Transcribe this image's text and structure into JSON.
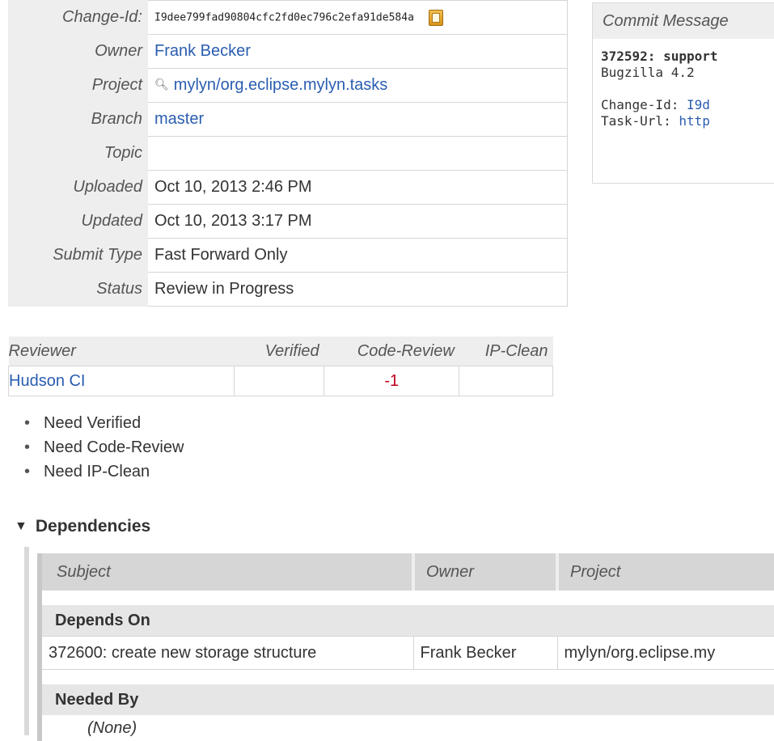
{
  "info": {
    "rows": [
      {
        "label": "Change-Id:",
        "value": "I9dee799fad90804cfc2fd0ec796c2efa91de584a"
      },
      {
        "label": "Owner",
        "value": "Frank Becker"
      },
      {
        "label": "Project",
        "value": "mylyn/org.eclipse.mylyn.tasks"
      },
      {
        "label": "Branch",
        "value": "master"
      },
      {
        "label": "Topic",
        "value": ""
      },
      {
        "label": "Uploaded",
        "value": "Oct 10, 2013 2:46 PM"
      },
      {
        "label": "Updated",
        "value": "Oct 10, 2013 3:17 PM"
      },
      {
        "label": "Submit Type",
        "value": "Fast Forward Only"
      },
      {
        "label": "Status",
        "value": "Review in Progress"
      }
    ]
  },
  "commit": {
    "header": "Commit Message",
    "subject": "372592: support",
    "line2": "Bugzilla 4.2",
    "change_id_key": "Change-Id: ",
    "change_id_val": "I9d",
    "task_url_key": "Task-Url: ",
    "task_url_val": "http"
  },
  "reviewers": {
    "columns": [
      "Reviewer",
      "Verified",
      "Code-Review",
      "IP-Clean"
    ],
    "rows": [
      {
        "name": "Hudson CI",
        "verified": "",
        "code_review": "-1",
        "ip_clean": ""
      }
    ]
  },
  "needs": [
    "Need Verified",
    "Need Code-Review",
    "Need IP-Clean"
  ],
  "dependencies": {
    "title": "Dependencies",
    "columns": [
      "Subject",
      "Owner",
      "Project"
    ],
    "depends_on_label": "Depends On",
    "depends_on": [
      {
        "subject": "372600: create new storage structure",
        "owner": "Frank Becker",
        "project": "mylyn/org.eclipse.my"
      }
    ],
    "needed_by_label": "Needed By",
    "needed_by_none": "(None)"
  }
}
